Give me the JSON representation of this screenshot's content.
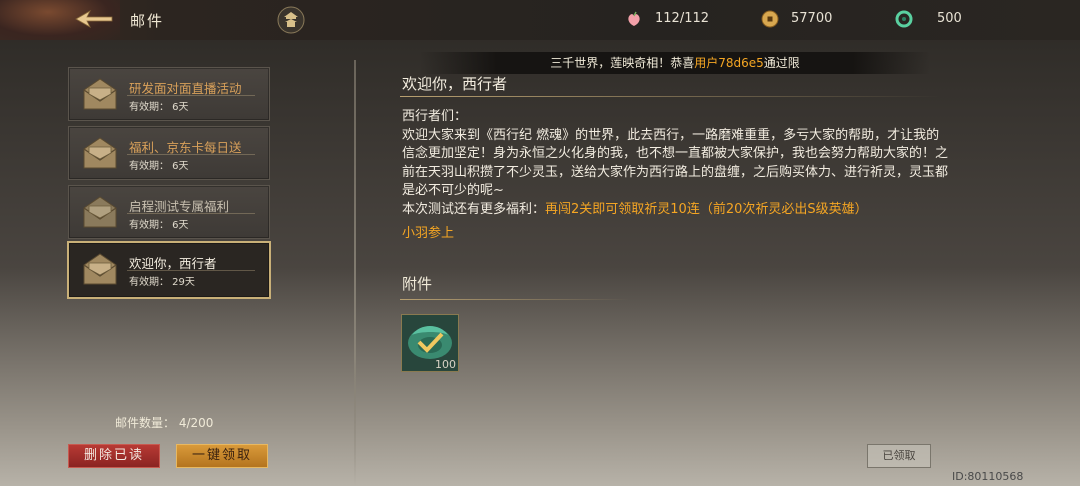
{
  "header": {
    "title": "邮件",
    "stamina": "112/112",
    "coins": "57700",
    "jade": "500"
  },
  "marquee": {
    "prefix": "三千世界，莲映奇相！恭喜",
    "user": "用户78d6e5",
    "suffix": "通过限"
  },
  "mail_list": [
    {
      "title": "研发面对面直播活动",
      "expiry": "有效期： 6天"
    },
    {
      "title": "福利、京东卡每日送",
      "expiry": "有效期： 6天"
    },
    {
      "title": "启程测试专属福利",
      "expiry": "有效期： 6天"
    },
    {
      "title": "欢迎你，西行者",
      "expiry": "有效期： 29天"
    }
  ],
  "footer_left": {
    "mail_count": "邮件数量： 4/200",
    "delete_read": "删除已读",
    "claim_all": "一键领取"
  },
  "mail_detail": {
    "heading": "欢迎你，西行者",
    "greeting": "西行者们：",
    "paragraph": "欢迎大家来到《西行纪 燃魂》的世界，此去西行，一路磨难重重，多亏大家的帮助，才让我的信念更加坚定！身为永恒之火化身的我，也不想一直都被大家保护，我也会努力帮助大家的！之前在天羽山积攒了不少灵玉，送给大家作为西行路上的盘缠，之后购买体力、进行祈灵，灵玉都是必不可少的呢~",
    "welfare_prefix": "本次测试还有更多福利：",
    "welfare_highlight": "再闯2关即可领取祈灵10连（前20次祈灵必出S级英雄）",
    "signature": "小羽参上",
    "attachment_heading": "附件",
    "attachment_qty": "100",
    "claimed_label": "已领取"
  },
  "player_id": "ID:80110568",
  "colors": {
    "accent_orange": "#f5a623",
    "gold_border": "#c9b078",
    "delete_red": "#b83a34",
    "claim_gold": "#d99a3a"
  }
}
